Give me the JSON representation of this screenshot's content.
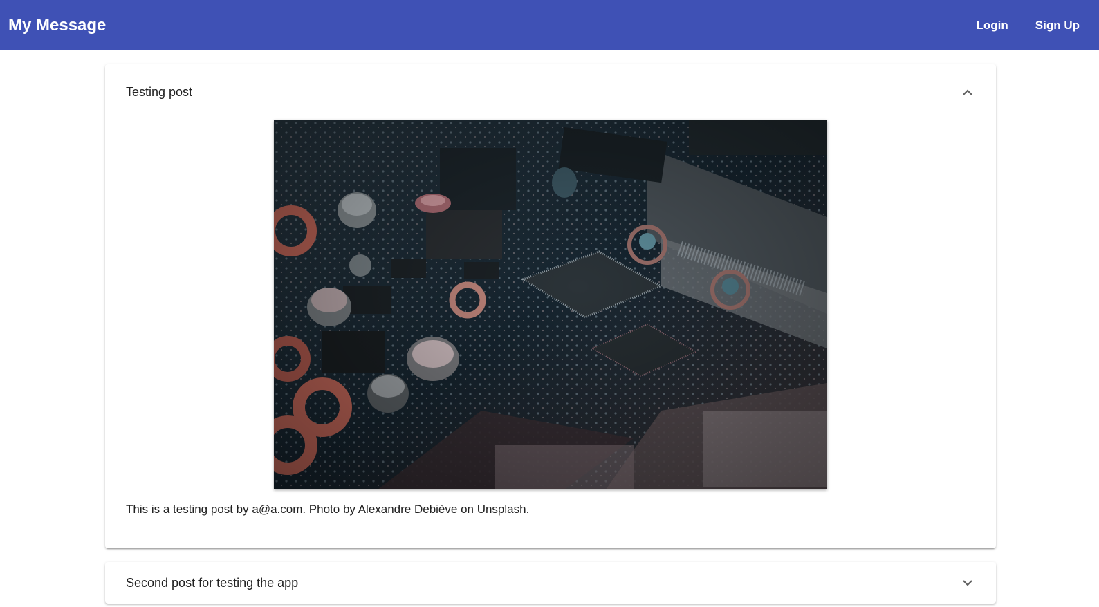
{
  "toolbar": {
    "title": "My Message",
    "login_label": "Login",
    "signup_label": "Sign Up",
    "background_color": "#3f51b5"
  },
  "posts": [
    {
      "title": "Testing post",
      "expanded": true,
      "image_alt": "Circuit board close-up",
      "content": "This is a testing post by a@a.com. Photo by Alexandre Debiève on Unsplash.",
      "toggle_icon": "chevron-up-icon"
    },
    {
      "title": "Second post for testing the app",
      "expanded": false,
      "toggle_icon": "chevron-down-icon"
    }
  ]
}
